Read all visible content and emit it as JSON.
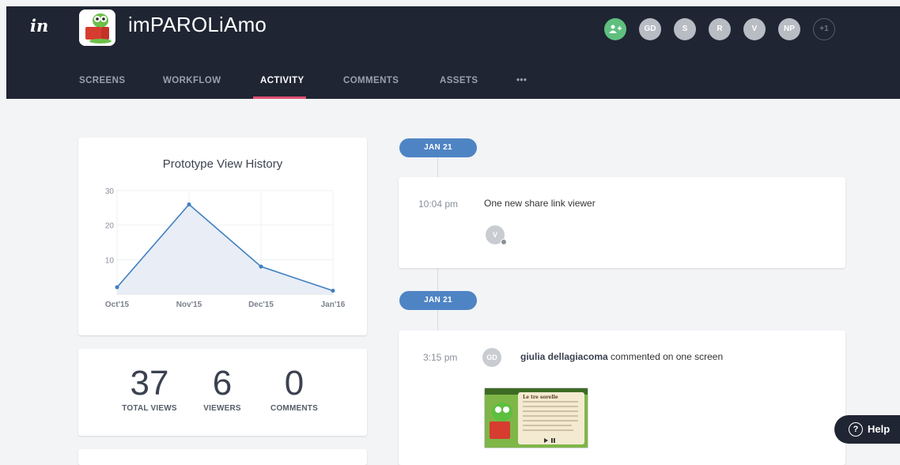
{
  "header": {
    "logo": "in",
    "app_title": "imPAROLiAmo",
    "collaborators": [
      "GD",
      "S",
      "R",
      "V",
      "NP"
    ],
    "more_collaborators": "+1"
  },
  "tabs": [
    {
      "label": "SCREENS"
    },
    {
      "label": "WORKFLOW"
    },
    {
      "label": "ACTIVITY",
      "active": true
    },
    {
      "label": "COMMENTS"
    },
    {
      "label": "ASSETS"
    },
    {
      "label": "•••"
    }
  ],
  "chart_data": {
    "type": "area",
    "title": "Prototype View History",
    "categories": [
      "Oct'15",
      "Nov'15",
      "Dec'15",
      "Jan'16"
    ],
    "values": [
      2,
      26,
      8,
      1
    ],
    "ylim": [
      0,
      30
    ],
    "y_ticks": [
      "10",
      "20",
      "30"
    ],
    "grid": true
  },
  "stats": [
    {
      "value": "37",
      "label": "TOTAL VIEWS"
    },
    {
      "value": "6",
      "label": "VIEWERS"
    },
    {
      "value": "0",
      "label": "COMMENTS"
    }
  ],
  "timeline": [
    {
      "date": "JAN 21",
      "time": "10:04 pm",
      "text": "One new share link viewer",
      "avatar": "V"
    },
    {
      "date": "JAN 21",
      "time": "3:15 pm",
      "user": "giulia dellagiacoma",
      "text": "commented on one screen",
      "avatar": "GD",
      "thumbnail_title": "Le tre sorelle"
    }
  ],
  "help": {
    "label": "Help",
    "icon": "?"
  },
  "colors": {
    "header_bg": "#1f2533",
    "accent": "#e34d74",
    "date_pill": "#4f84c4",
    "chart_line": "#3f7fc0",
    "invite": "#5fbf7f"
  }
}
